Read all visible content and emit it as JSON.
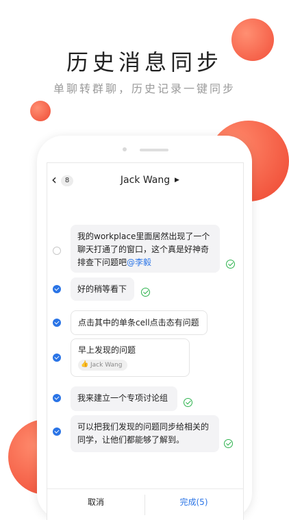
{
  "title": "历史消息同步",
  "subtitle": "单聊转群聊，历史记录一键同步",
  "nav": {
    "back_badge": "8",
    "contact_name": "Jack Wang"
  },
  "messages": [
    {
      "text": "我的workplace里面居然出现了一个聊天打通了的窗口，这个真是好神奇排查下问题吧",
      "mention": "@李毅",
      "selected": false
    },
    {
      "text": "好的稍等看下",
      "selected": true
    },
    {
      "text": "点击其中的单条cell点击态有问题",
      "selected": true
    },
    {
      "text": "早上发现的问题",
      "reaction_user": "Jack Wang",
      "selected": true
    },
    {
      "text": "我来建立一个专项讨论组",
      "selected": true
    },
    {
      "text": "可以把我们发现的问题同步给相关的同学，让他们都能够了解到。",
      "selected": true
    }
  ],
  "footer": {
    "cancel": "取消",
    "done": "完成(5)"
  },
  "colors": {
    "accent_red": "#f2503a",
    "accent_blue": "#2a74e6",
    "check_green": "#2bb24c"
  }
}
